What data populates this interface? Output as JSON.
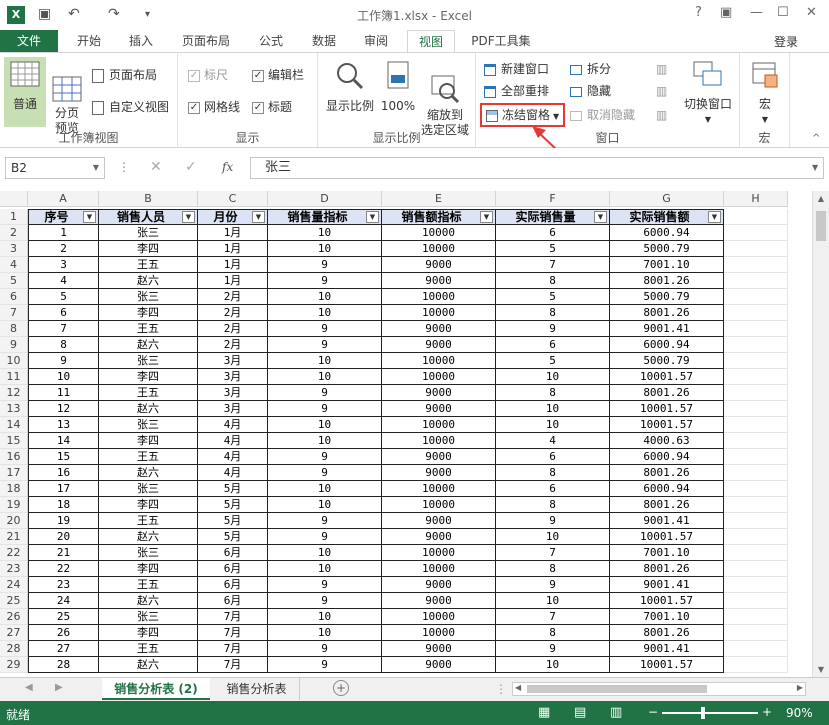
{
  "window": {
    "title": "工作簿1.xlsx - Excel"
  },
  "tabs": [
    {
      "label": "文件"
    },
    {
      "label": "开始"
    },
    {
      "label": "插入"
    },
    {
      "label": "页面布局"
    },
    {
      "label": "公式"
    },
    {
      "label": "数据"
    },
    {
      "label": "审阅"
    },
    {
      "label": "视图"
    },
    {
      "label": "PDF工具集"
    }
  ],
  "login": "登录",
  "ribbon": {
    "workbook_views": {
      "label": "工作簿视图",
      "normal": "普通",
      "page_break": "分页\n预览",
      "page_layout": "页面布局",
      "custom_views": "自定义视图"
    },
    "show": {
      "label": "显示",
      "ruler": "标尺",
      "gridlines": "网格线",
      "formula_bar": "编辑栏",
      "headings": "标题"
    },
    "zoom": {
      "label": "显示比例",
      "zoom": "显示比例",
      "hundred": "100%",
      "zoom_selection": "缩放到\n选定区域"
    },
    "window": {
      "label": "窗口",
      "new_window": "新建窗口",
      "arrange_all": "全部重排",
      "freeze_panes": "冻结窗格",
      "split": "拆分",
      "hide": "隐藏",
      "unhide": "取消隐藏",
      "switch_windows": "切换窗口"
    },
    "macros": {
      "label": "宏",
      "macros": "宏"
    }
  },
  "formula_bar": {
    "name_box": "B2",
    "fx": "fx",
    "content": "张三"
  },
  "columns": [
    "A",
    "B",
    "C",
    "D",
    "E",
    "F",
    "G",
    "H"
  ],
  "headers": [
    "序号",
    "销售人员",
    "月份",
    "销售量指标",
    "销售额指标",
    "实际销售量",
    "实际销售额"
  ],
  "rows": [
    [
      "1",
      "张三",
      "1月",
      "10",
      "10000",
      "6",
      "6000.94"
    ],
    [
      "2",
      "李四",
      "1月",
      "10",
      "10000",
      "5",
      "5000.79"
    ],
    [
      "3",
      "王五",
      "1月",
      "9",
      "9000",
      "7",
      "7001.10"
    ],
    [
      "4",
      "赵六",
      "1月",
      "9",
      "9000",
      "8",
      "8001.26"
    ],
    [
      "5",
      "张三",
      "2月",
      "10",
      "10000",
      "5",
      "5000.79"
    ],
    [
      "6",
      "李四",
      "2月",
      "10",
      "10000",
      "8",
      "8001.26"
    ],
    [
      "7",
      "王五",
      "2月",
      "9",
      "9000",
      "9",
      "9001.41"
    ],
    [
      "8",
      "赵六",
      "2月",
      "9",
      "9000",
      "6",
      "6000.94"
    ],
    [
      "9",
      "张三",
      "3月",
      "10",
      "10000",
      "5",
      "5000.79"
    ],
    [
      "10",
      "李四",
      "3月",
      "10",
      "10000",
      "10",
      "10001.57"
    ],
    [
      "11",
      "王五",
      "3月",
      "9",
      "9000",
      "8",
      "8001.26"
    ],
    [
      "12",
      "赵六",
      "3月",
      "9",
      "9000",
      "10",
      "10001.57"
    ],
    [
      "13",
      "张三",
      "4月",
      "10",
      "10000",
      "10",
      "10001.57"
    ],
    [
      "14",
      "李四",
      "4月",
      "10",
      "10000",
      "4",
      "4000.63"
    ],
    [
      "15",
      "王五",
      "4月",
      "9",
      "9000",
      "6",
      "6000.94"
    ],
    [
      "16",
      "赵六",
      "4月",
      "9",
      "9000",
      "8",
      "8001.26"
    ],
    [
      "17",
      "张三",
      "5月",
      "10",
      "10000",
      "6",
      "6000.94"
    ],
    [
      "18",
      "李四",
      "5月",
      "10",
      "10000",
      "8",
      "8001.26"
    ],
    [
      "19",
      "王五",
      "5月",
      "9",
      "9000",
      "9",
      "9001.41"
    ],
    [
      "20",
      "赵六",
      "5月",
      "9",
      "9000",
      "10",
      "10001.57"
    ],
    [
      "21",
      "张三",
      "6月",
      "10",
      "10000",
      "7",
      "7001.10"
    ],
    [
      "22",
      "李四",
      "6月",
      "10",
      "10000",
      "8",
      "8001.26"
    ],
    [
      "23",
      "王五",
      "6月",
      "9",
      "9000",
      "9",
      "9001.41"
    ],
    [
      "24",
      "赵六",
      "6月",
      "9",
      "9000",
      "10",
      "10001.57"
    ],
    [
      "25",
      "张三",
      "7月",
      "10",
      "10000",
      "7",
      "7001.10"
    ],
    [
      "26",
      "李四",
      "7月",
      "10",
      "10000",
      "8",
      "8001.26"
    ],
    [
      "27",
      "王五",
      "7月",
      "9",
      "9000",
      "9",
      "9001.41"
    ],
    [
      "28",
      "赵六",
      "7月",
      "9",
      "9000",
      "10",
      "10001.57"
    ]
  ],
  "sheets": [
    "销售分析表 (2)",
    "销售分析表"
  ],
  "status": {
    "ready": "就绪",
    "zoom": "90%"
  },
  "colors": {
    "accent": "#217346",
    "header_fill": "#dce3f4",
    "highlight": "#e53935"
  }
}
